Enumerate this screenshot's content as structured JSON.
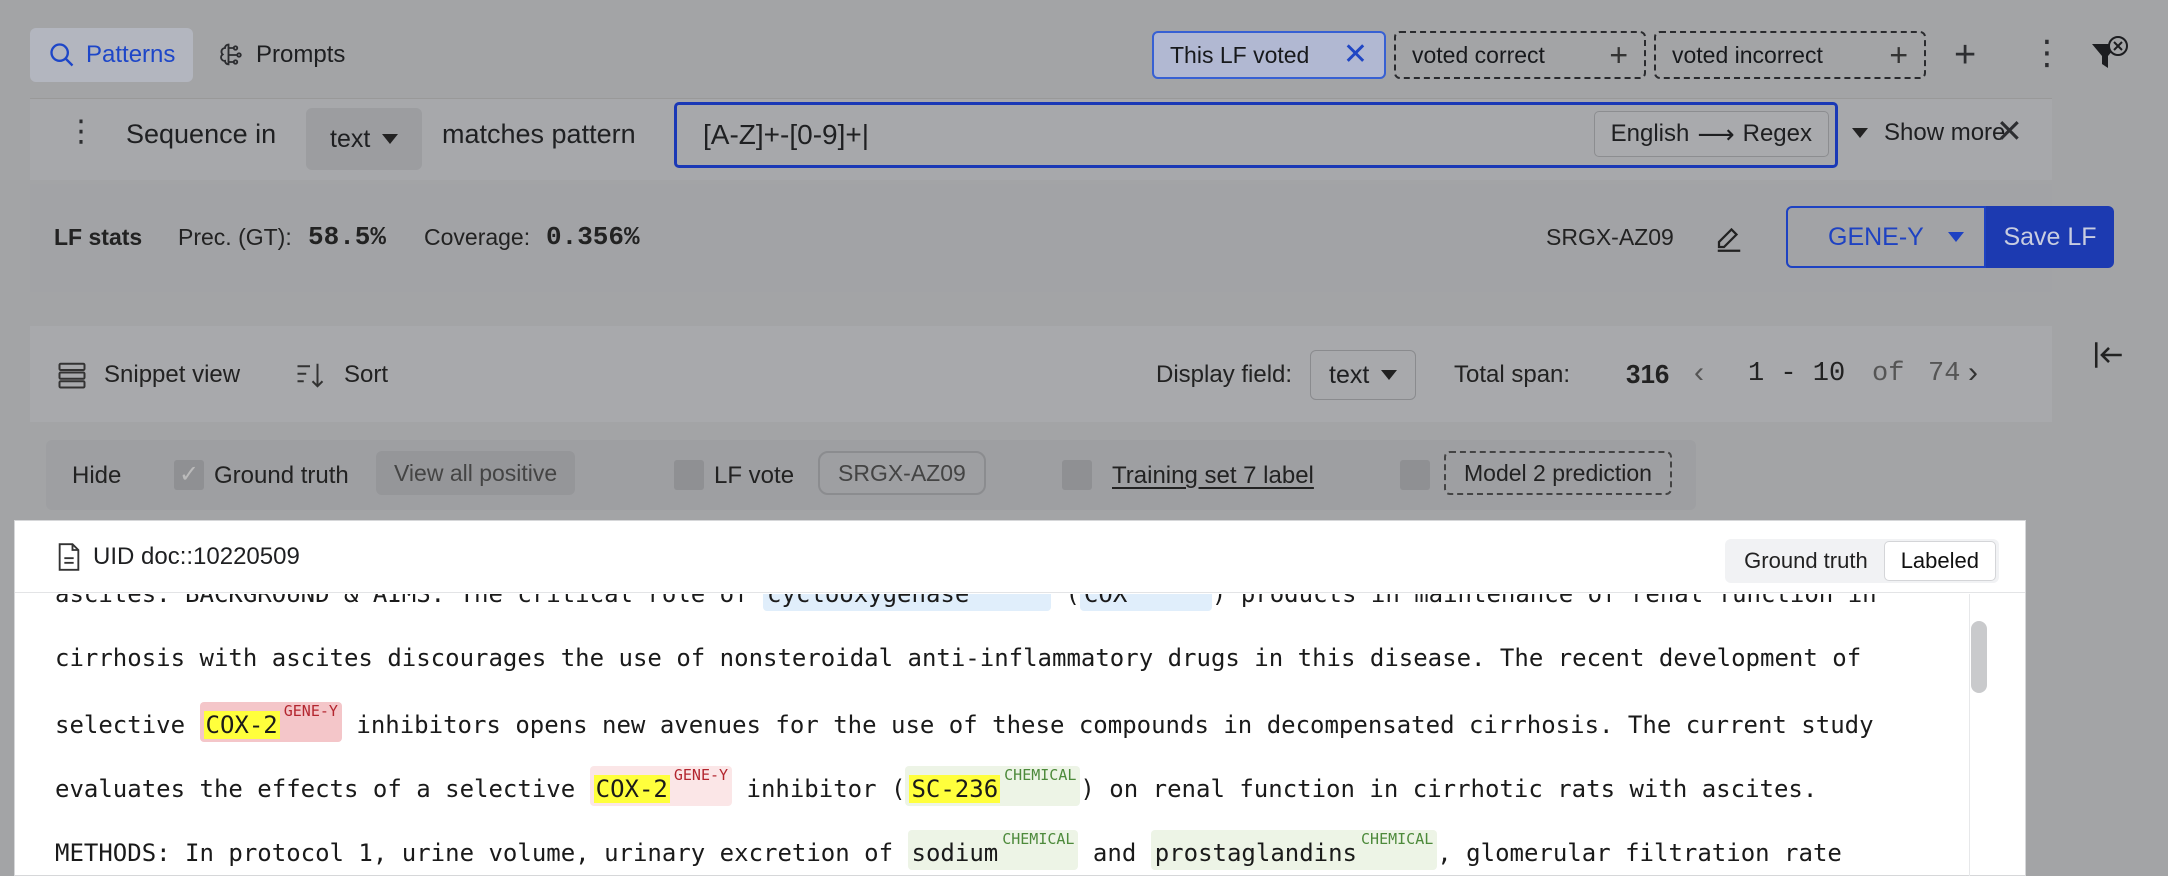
{
  "tabs": [
    {
      "label": "Patterns",
      "icon": "search-icon",
      "active": true
    },
    {
      "label": "Prompts",
      "icon": "brain-icon",
      "active": false
    }
  ],
  "filter_chips": [
    {
      "label": "This LF voted",
      "style": "solid"
    },
    {
      "label": "voted correct",
      "style": "dashed"
    },
    {
      "label": "voted incorrect",
      "style": "dashed"
    }
  ],
  "query": {
    "prefix": "Sequence in",
    "field": "text",
    "operator": "matches pattern",
    "pattern": "[A-Z]+-[0-9]+|",
    "translate_from": "English",
    "translate_to": "Regex",
    "show_more": "Show more"
  },
  "stats": {
    "title": "LF stats",
    "precision_label": "Prec. (GT):",
    "precision_value": "58.5%",
    "coverage_label": "Coverage:",
    "coverage_value": "0.356%",
    "lf_name": "SRGX-AZ09",
    "label_value": "GENE-Y",
    "save_label": "Save LF"
  },
  "results": {
    "view_label": "Snippet view",
    "sort_label": "Sort",
    "display_field_label": "Display field:",
    "display_field_value": "text",
    "total_span_label": "Total span:",
    "total_span_value": "316",
    "range": "1 - 10",
    "of_label": "of",
    "total": "74"
  },
  "filters": {
    "hide": "Hide",
    "ground_truth": "Ground truth",
    "view_all_positive": "View all positive",
    "lf_vote": "LF vote",
    "lf_vote_value": "SRGX-AZ09",
    "training_set": "Training set 7 label",
    "model_prediction": "Model 2 prediction"
  },
  "document": {
    "uid": "UID doc::10220509",
    "toggle_label": "Ground truth",
    "toggle_value": "Labeled",
    "lines": {
      "l0_pre": "ascites. BACKGROUND & AIMS: The critical role of ",
      "l0_ent1": "cyclooxygenase",
      "l0_mid": " (",
      "l0_ent2": "COX",
      "l0_post": ") products in maintenance of renal function in",
      "l1": "cirrhosis with ascites discourages the use of nonsteroidal anti-inflammatory drugs in this disease. The recent development of",
      "l2_pre": "selective ",
      "l2_ent": "COX-2",
      "l2_tag": "GENE-Y",
      "l2_post": " inhibitors opens new avenues for the use of these compounds in decompensated cirrhosis. The current study",
      "l3_pre": "evaluates the effects of a selective ",
      "l3_ent1": "COX-2",
      "l3_tag1": "GENE-Y",
      "l3_mid": " inhibitor (",
      "l3_ent2": "SC-236",
      "l3_tag2": "CHEMICAL",
      "l3_post": ") on renal function in cirrhotic rats with ascites.",
      "l4_pre": "METHODS: In protocol 1, urine volume, urinary excretion of ",
      "l4_ent1": "sodium",
      "l4_tag1": "CHEMICAL",
      "l4_mid": " and ",
      "l4_ent2": "prostaglandins",
      "l4_tag2": "CHEMICAL",
      "l4_post": ", glomerular filtration rate"
    }
  },
  "colors": {
    "accent": "#1d46c8",
    "gene_tag": "#b3262f",
    "chemical_tag": "#4d8a3b",
    "highlight": "#ffff3c"
  }
}
